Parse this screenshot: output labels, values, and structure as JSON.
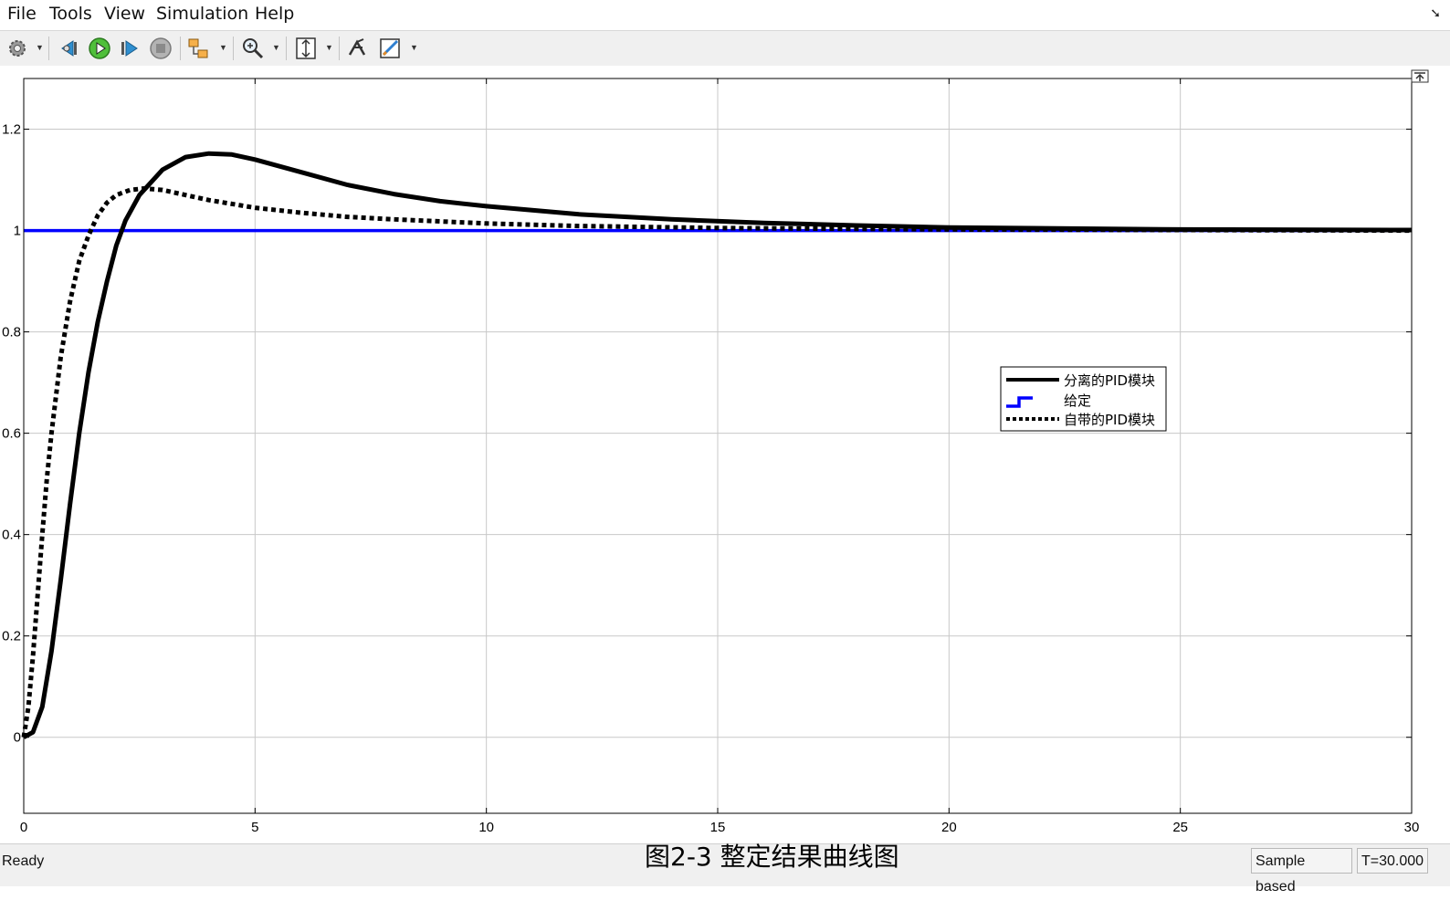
{
  "menu": [
    "File",
    "Tools",
    "View",
    "Simulation",
    "Help"
  ],
  "toolbar": {
    "icons": [
      "gear-icon",
      "step-back-icon",
      "run-icon",
      "step-forward-icon",
      "stop-icon",
      "highlight-model-icon",
      "zoom-icon",
      "fit-view-icon",
      "restore-icon",
      "style-icon"
    ]
  },
  "colors": {
    "reference": "#0000ff",
    "pid_curves": "#000000",
    "grid": "#c8c8c8"
  },
  "chart_data": {
    "type": "line",
    "title": "",
    "xlabel": "",
    "ylabel": "",
    "xlim": [
      0,
      30
    ],
    "ylim": [
      -0.15,
      1.3
    ],
    "x_ticks": [
      0,
      5,
      10,
      15,
      20,
      25,
      30
    ],
    "y_ticks": [
      0,
      0.2,
      0.4,
      0.6,
      0.8,
      1,
      1.2
    ],
    "x_tick_labels": [
      "0",
      "5",
      "10",
      "15",
      "20",
      "25",
      "30"
    ],
    "y_tick_labels": [
      "0",
      "0.2",
      "0.4",
      "0.6",
      "0.8",
      "1",
      "1.2"
    ],
    "grid": true,
    "legend_position": "right-middle",
    "series": [
      {
        "name": "分离的PID模块",
        "style": "solid",
        "color": "#000000",
        "points": [
          [
            0,
            0
          ],
          [
            0.2,
            0.01
          ],
          [
            0.4,
            0.06
          ],
          [
            0.6,
            0.17
          ],
          [
            0.8,
            0.31
          ],
          [
            1.0,
            0.46
          ],
          [
            1.2,
            0.6
          ],
          [
            1.4,
            0.72
          ],
          [
            1.6,
            0.82
          ],
          [
            1.8,
            0.9
          ],
          [
            2.0,
            0.97
          ],
          [
            2.2,
            1.02
          ],
          [
            2.5,
            1.07
          ],
          [
            3.0,
            1.12
          ],
          [
            3.5,
            1.145
          ],
          [
            4.0,
            1.152
          ],
          [
            4.5,
            1.15
          ],
          [
            5.0,
            1.14
          ],
          [
            6.0,
            1.115
          ],
          [
            7.0,
            1.09
          ],
          [
            8.0,
            1.072
          ],
          [
            9.0,
            1.058
          ],
          [
            10.0,
            1.048
          ],
          [
            12.0,
            1.032
          ],
          [
            14.0,
            1.022
          ],
          [
            16.0,
            1.015
          ],
          [
            18.0,
            1.01
          ],
          [
            20.0,
            1.006
          ],
          [
            25.0,
            1.002
          ],
          [
            30.0,
            1.001
          ]
        ]
      },
      {
        "name": "给定",
        "style": "solid",
        "color": "#0000ff",
        "points": [
          [
            0,
            1
          ],
          [
            30,
            1
          ]
        ]
      },
      {
        "name": "自带的PID模块",
        "style": "dotted",
        "color": "#000000",
        "points": [
          [
            0,
            0
          ],
          [
            0.1,
            0.06
          ],
          [
            0.2,
            0.16
          ],
          [
            0.3,
            0.28
          ],
          [
            0.4,
            0.4
          ],
          [
            0.5,
            0.51
          ],
          [
            0.6,
            0.6
          ],
          [
            0.8,
            0.75
          ],
          [
            1.0,
            0.86
          ],
          [
            1.2,
            0.94
          ],
          [
            1.4,
            0.99
          ],
          [
            1.6,
            1.03
          ],
          [
            1.8,
            1.055
          ],
          [
            2.0,
            1.07
          ],
          [
            2.3,
            1.08
          ],
          [
            2.6,
            1.083
          ],
          [
            3.0,
            1.08
          ],
          [
            3.5,
            1.07
          ],
          [
            4.0,
            1.06
          ],
          [
            5.0,
            1.045
          ],
          [
            6.0,
            1.035
          ],
          [
            7.0,
            1.027
          ],
          [
            8.0,
            1.022
          ],
          [
            10.0,
            1.014
          ],
          [
            12.0,
            1.009
          ],
          [
            15.0,
            1.005
          ],
          [
            20.0,
            1.002
          ],
          [
            30.0,
            1.0
          ]
        ]
      }
    ]
  },
  "status": {
    "ready": "Ready",
    "caption": "图2-3 整定结果曲线图",
    "sample_mode": "Sample based",
    "time": "T=30.000"
  }
}
